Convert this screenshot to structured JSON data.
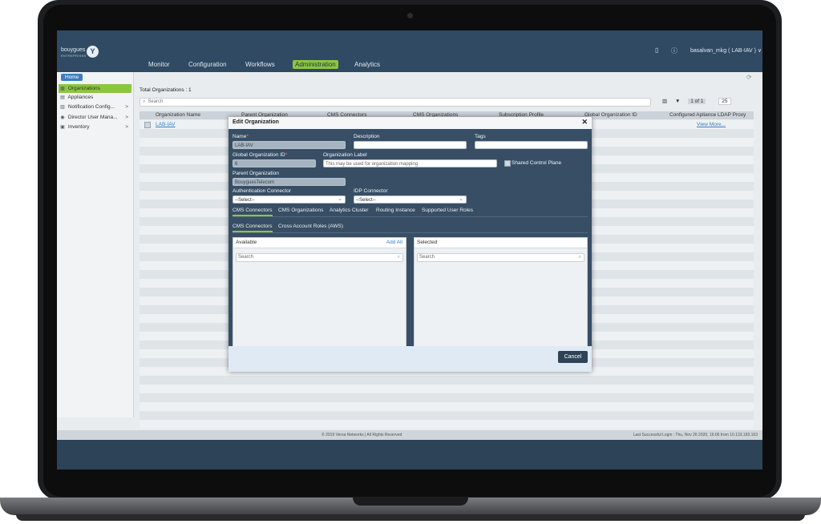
{
  "brand": {
    "name": "bouygues",
    "sub": "ENTREPRISES",
    "mark": "Y"
  },
  "nav": [
    "Monitor",
    "Configuration",
    "Workflows",
    "Administration",
    "Analytics"
  ],
  "user": "basalvan_mkg ( LAB-IAV ) ∨",
  "home_label": "Home",
  "sidebar": [
    {
      "label": "Organizations",
      "icon": "▦",
      "chev": ""
    },
    {
      "label": "Appliances",
      "icon": "▤",
      "chev": ""
    },
    {
      "label": "Notification Config...",
      "icon": "▥",
      "chev": ">"
    },
    {
      "label": "Director User Mana...",
      "icon": "◉",
      "chev": ">"
    },
    {
      "label": "Inventory",
      "icon": "▣",
      "chev": ">"
    }
  ],
  "main": {
    "title": "Total Organizations : 1",
    "search_placeholder": "Search",
    "pager": "1 of 1",
    "page_size": "25",
    "columns": [
      "Organization Name",
      "Parent Organization",
      "CMS Connectors",
      "CMS Organizations",
      "Subscription Profile",
      "Global Organization ID",
      "Configured Apliance LDAP Proxy"
    ],
    "row": {
      "name": "LAB-IAV",
      "ldap": "View More..."
    }
  },
  "footer": {
    "copyright": "© 2019 Versa Networks | All Rights Reserved",
    "login": "Last Successful Login : Thu, Nov 26 2020, 16:06 from 10.133.183.163"
  },
  "modal": {
    "title": "Edit Organization",
    "close": "✕",
    "name_label": "Name",
    "name_value": "LAB-IAV",
    "description_label": "Description",
    "tags_label": "Tags",
    "global_id_label": "Global Organization ID",
    "global_id_value": "6",
    "org_label_label": "Organization Label",
    "org_label_placeholder": "This may be used for organization mapping",
    "shared_cp_label": "Shared Control Plane",
    "parent_label": "Parent Organization",
    "parent_value": "BouyguesTelecom",
    "auth_label": "Authentication Connector",
    "auth_value": "--Select--",
    "idp_label": "IDP Connector",
    "idp_value": "--Select--",
    "tabs": [
      "CMS Connectors",
      "CMS Organizations",
      "Analytics Cluster",
      "Routing Instance",
      "Supported User Roles"
    ],
    "subtabs": [
      "CMS Connectors",
      "Cross Account Roles (AWS)"
    ],
    "available_label": "Available",
    "add_all": "Add All",
    "selected_label": "Selected",
    "search_placeholder": "Search",
    "cancel": "Cancel"
  }
}
